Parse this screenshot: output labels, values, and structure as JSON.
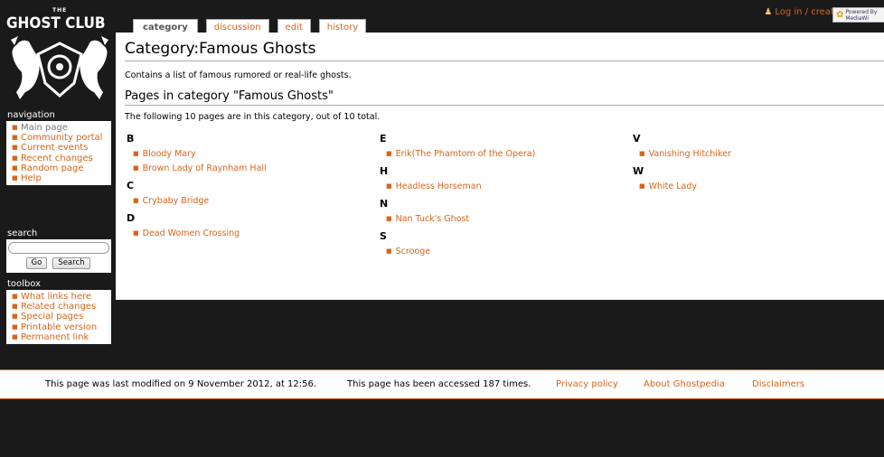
{
  "logo": {
    "top": "THE",
    "name": "GHOST CLUB"
  },
  "personal": {
    "label": "Log in / create account"
  },
  "tabs": [
    {
      "label": "category"
    },
    {
      "label": "discussion"
    },
    {
      "label": "edit"
    },
    {
      "label": "history"
    }
  ],
  "page": {
    "title": "Category:Famous Ghosts",
    "intro": "Contains a list of famous rumored or real-life ghosts.",
    "subheading": "Pages in category \"Famous Ghosts\"",
    "summary": "The following 10 pages are in this category, out of 10 total."
  },
  "columns": [
    [
      {
        "letter": "B",
        "entries": [
          "Bloody Mary",
          "Brown Lady of Raynham Hall"
        ]
      },
      {
        "letter": "C",
        "entries": [
          "Crybaby Bridge"
        ]
      },
      {
        "letter": "D",
        "entries": [
          "Dead Women Crossing"
        ]
      }
    ],
    [
      {
        "letter": "E",
        "entries": [
          "Erik(The Phamtom of the Opera)"
        ]
      },
      {
        "letter": "H",
        "entries": [
          "Headless Horseman"
        ]
      },
      {
        "letter": "N",
        "entries": [
          "Nan Tuck's Ghost"
        ]
      },
      {
        "letter": "S",
        "entries": [
          "Scrooge"
        ]
      }
    ],
    [
      {
        "letter": "V",
        "entries": [
          "Vanishing Hitchiker"
        ]
      },
      {
        "letter": "W",
        "entries": [
          "White Lady"
        ]
      }
    ]
  ],
  "sidebar": {
    "navigation": {
      "title": "navigation",
      "items": [
        "Main page",
        "Community portal",
        "Current events",
        "Recent changes",
        "Random page",
        "Help"
      ]
    },
    "search": {
      "title": "search",
      "placeholder": "",
      "go_label": "Go",
      "search_label": "Search"
    },
    "toolbox": {
      "title": "toolbox",
      "items": [
        "What links here",
        "Related changes",
        "Special pages",
        "Printable version",
        "Permanent link"
      ]
    }
  },
  "footer": {
    "lastmod": "This page was last modified on 9 November 2012, at 12:56.",
    "viewcount": "This page has been accessed 187 times.",
    "privacy": "Privacy policy",
    "about": "About Ghostpedia",
    "disclaimers": "Disclaimers",
    "powered": [
      "Powered By",
      "MediaWi"
    ]
  },
  "colors": {
    "accent": "#d8641a",
    "background": "#1a1a1a"
  }
}
